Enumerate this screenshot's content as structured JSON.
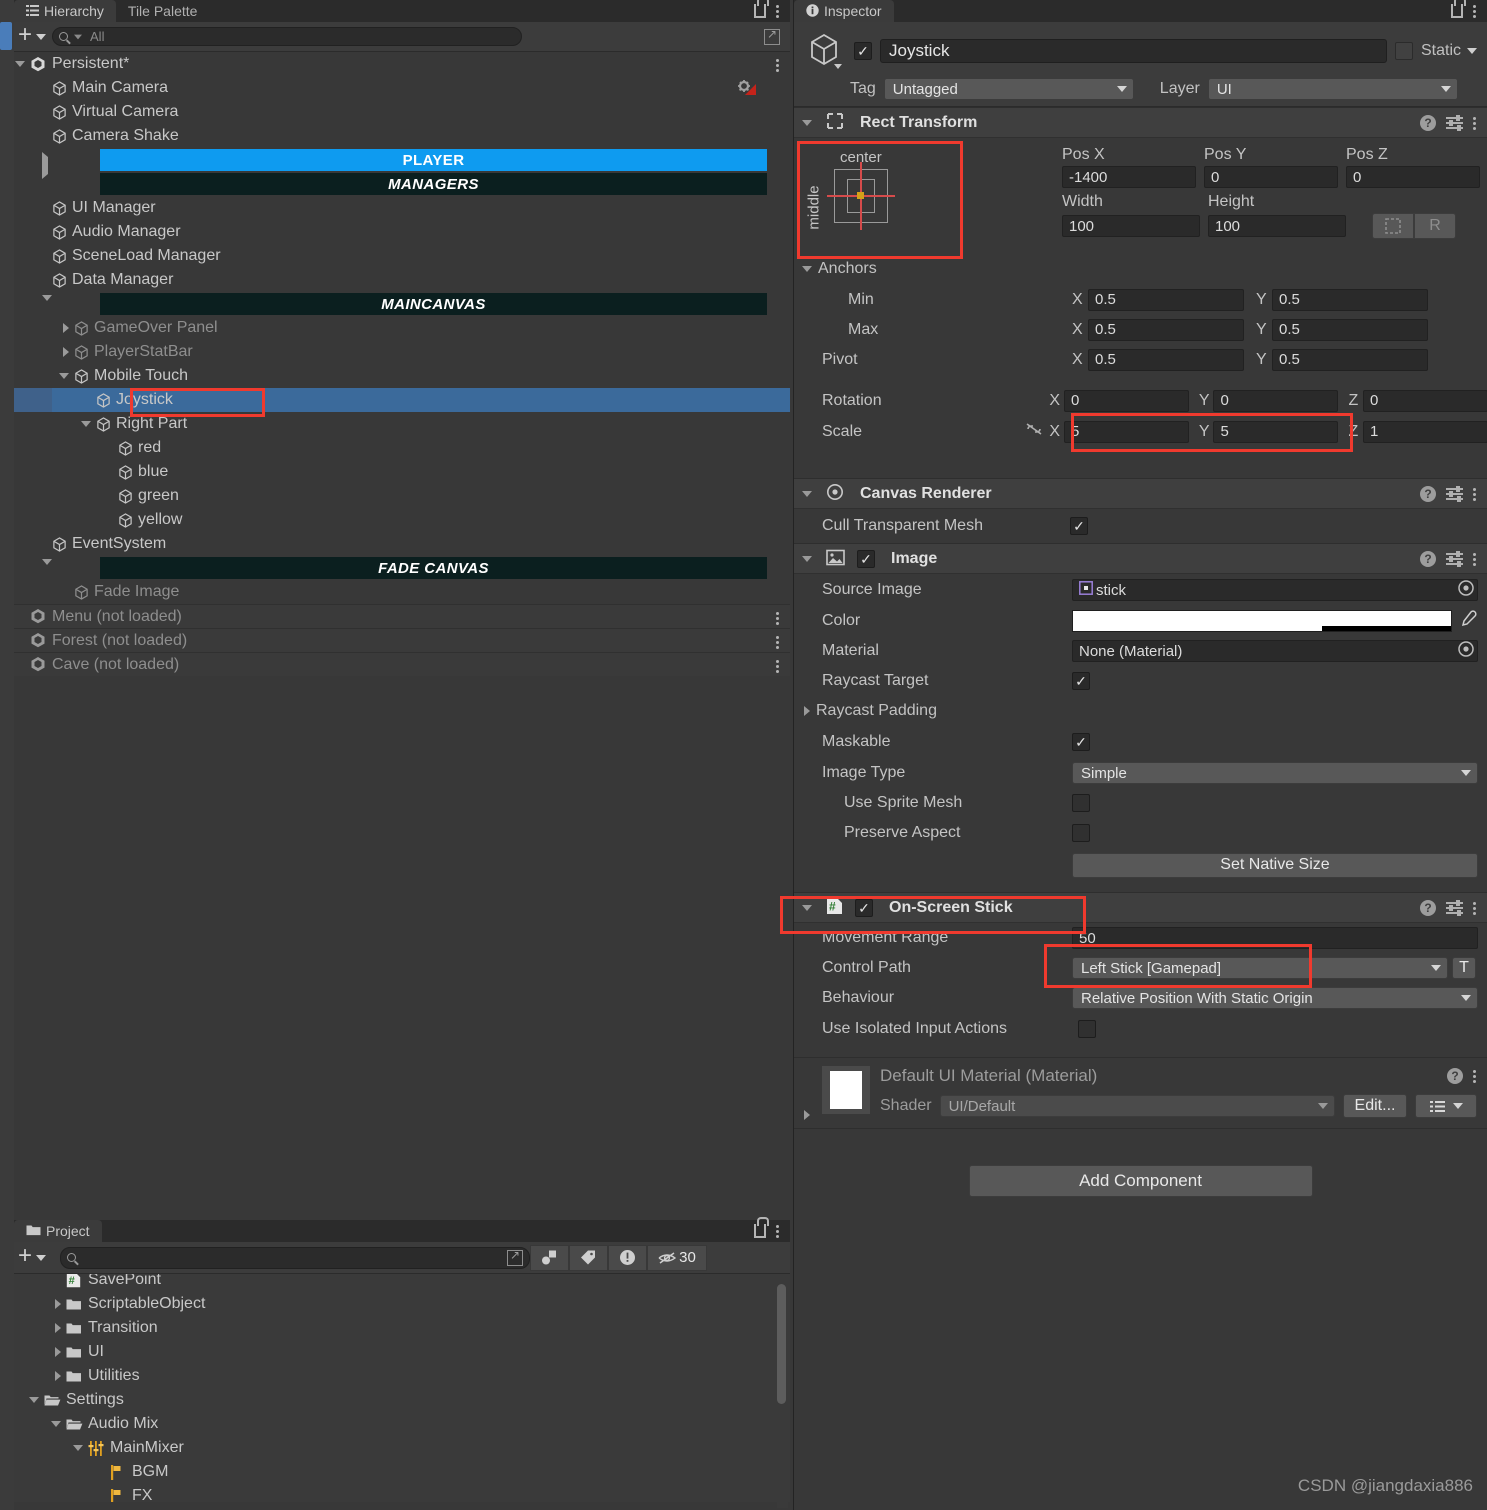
{
  "hierarchy": {
    "tabs": [
      {
        "label": "Hierarchy",
        "icon": "hierarchy-icon",
        "active": true
      },
      {
        "label": "Tile Palette",
        "icon": "tile-palette-icon",
        "active": false
      }
    ],
    "toolbar": {
      "add_label": "+",
      "search_placeholder": "All",
      "search_value": ""
    },
    "rows": [
      {
        "label": "Persistent*",
        "indent": 0,
        "twisty": "down",
        "icon": "unity-scene-icon",
        "kind": "scene",
        "menu": true
      },
      {
        "label": "Main Camera",
        "indent": 1,
        "twisty": "none",
        "icon": "gameobject-icon",
        "kind": "normal",
        "right_icon": "camera-audio-icon"
      },
      {
        "label": "Virtual Camera",
        "indent": 1,
        "twisty": "none",
        "icon": "gameobject-icon",
        "kind": "normal"
      },
      {
        "label": "Camera Shake",
        "indent": 1,
        "twisty": "none",
        "icon": "gameobject-icon",
        "kind": "normal"
      },
      {
        "label": "PLAYER",
        "indent": 1,
        "twisty": "right",
        "icon": "none",
        "kind": "banner-blue"
      },
      {
        "label": "MANAGERS",
        "indent": 1,
        "twisty": "none",
        "icon": "none",
        "kind": "banner-dark"
      },
      {
        "label": "UI Manager",
        "indent": 1,
        "twisty": "none",
        "icon": "gameobject-icon",
        "kind": "normal"
      },
      {
        "label": "Audio Manager",
        "indent": 1,
        "twisty": "none",
        "icon": "gameobject-icon",
        "kind": "normal"
      },
      {
        "label": "SceneLoad Manager",
        "indent": 1,
        "twisty": "none",
        "icon": "gameobject-icon",
        "kind": "normal"
      },
      {
        "label": "Data Manager",
        "indent": 1,
        "twisty": "none",
        "icon": "gameobject-icon",
        "kind": "normal"
      },
      {
        "label": "MAINCANVAS",
        "indent": 1,
        "twisty": "down",
        "icon": "none",
        "kind": "banner-dark"
      },
      {
        "label": "GameOver Panel",
        "indent": 2,
        "twisty": "right",
        "icon": "gameobject-icon",
        "kind": "dim"
      },
      {
        "label": "PlayerStatBar",
        "indent": 2,
        "twisty": "right",
        "icon": "gameobject-icon",
        "kind": "dim"
      },
      {
        "label": "Mobile Touch",
        "indent": 2,
        "twisty": "down",
        "icon": "gameobject-icon",
        "kind": "normal"
      },
      {
        "label": "Joystick",
        "indent": 3,
        "twisty": "none",
        "icon": "gameobject-icon",
        "kind": "selected"
      },
      {
        "label": "Right Part",
        "indent": 3,
        "twisty": "down",
        "icon": "gameobject-icon",
        "kind": "normal"
      },
      {
        "label": "red",
        "indent": 4,
        "twisty": "none",
        "icon": "gameobject-icon",
        "kind": "normal"
      },
      {
        "label": "blue",
        "indent": 4,
        "twisty": "none",
        "icon": "gameobject-icon",
        "kind": "normal"
      },
      {
        "label": "green",
        "indent": 4,
        "twisty": "none",
        "icon": "gameobject-icon",
        "kind": "normal"
      },
      {
        "label": "yellow",
        "indent": 4,
        "twisty": "none",
        "icon": "gameobject-icon",
        "kind": "normal"
      },
      {
        "label": "EventSystem",
        "indent": 1,
        "twisty": "none",
        "icon": "gameobject-icon",
        "kind": "normal"
      },
      {
        "label": "FADE CANVAS",
        "indent": 1,
        "twisty": "down",
        "icon": "none",
        "kind": "banner-dark"
      },
      {
        "label": "Fade Image",
        "indent": 2,
        "twisty": "none",
        "icon": "gameobject-icon",
        "kind": "dim"
      },
      {
        "label": "Menu (not loaded)",
        "indent": 0,
        "twisty": "none",
        "icon": "unity-scene-icon",
        "kind": "notloaded",
        "menu": true
      },
      {
        "label": "Forest (not loaded)",
        "indent": 0,
        "twisty": "none",
        "icon": "unity-scene-icon",
        "kind": "notloaded",
        "menu": true
      },
      {
        "label": "Cave (not loaded)",
        "indent": 0,
        "twisty": "none",
        "icon": "unity-scene-icon",
        "kind": "notloaded",
        "menu": true
      }
    ],
    "highlight_label": "Joystick"
  },
  "inspector": {
    "tab_label": "Inspector",
    "object": {
      "enabled": true,
      "name": "Joystick",
      "static_label": "Static",
      "static_checked": false,
      "tag_label": "Tag",
      "tag_value": "Untagged",
      "layer_label": "Layer",
      "layer_value": "UI"
    },
    "rect_transform": {
      "title": "Rect Transform",
      "anchor_preset": {
        "top_label": "center",
        "side_label": "middle"
      },
      "headers": {
        "pos_x": "Pos X",
        "pos_y": "Pos Y",
        "pos_z": "Pos Z",
        "width": "Width",
        "height": "Height"
      },
      "pos_x": "-1400",
      "pos_y": "0",
      "pos_z": "0",
      "width": "100",
      "height": "100",
      "blueprint_btn": "blueprint-icon",
      "rawedit_btn": "R",
      "anchors_label": "Anchors",
      "min_label": "Min",
      "min_x": "0.5",
      "min_y": "0.5",
      "max_label": "Max",
      "max_x": "0.5",
      "max_y": "0.5",
      "pivot_label": "Pivot",
      "pivot_x": "0.5",
      "pivot_y": "0.5",
      "rotation_label": "Rotation",
      "rot_x": "0",
      "rot_y": "0",
      "rot_z": "0",
      "scale_label": "Scale",
      "scale_x": "5",
      "scale_y": "5",
      "scale_z": "1",
      "axis_x": "X",
      "axis_y": "Y",
      "axis_z": "Z"
    },
    "canvas_renderer": {
      "title": "Canvas Renderer",
      "cull_label": "Cull Transparent Mesh",
      "cull_checked": true
    },
    "image": {
      "title": "Image",
      "enabled": true,
      "source_image_label": "Source Image",
      "source_image_value": "stick",
      "color_label": "Color",
      "color_value": "#FFFFFF",
      "color_alpha_pct": 66,
      "material_label": "Material",
      "material_value": "None (Material)",
      "raycast_target_label": "Raycast Target",
      "raycast_target_checked": true,
      "raycast_padding_label": "Raycast Padding",
      "maskable_label": "Maskable",
      "maskable_checked": true,
      "image_type_label": "Image Type",
      "image_type_value": "Simple",
      "use_sprite_mesh_label": "Use Sprite Mesh",
      "use_sprite_mesh_checked": false,
      "preserve_aspect_label": "Preserve Aspect",
      "preserve_aspect_checked": false,
      "set_native_size_label": "Set Native Size"
    },
    "on_screen_stick": {
      "title": "On-Screen Stick",
      "enabled": true,
      "movement_range_label": "Movement Range",
      "movement_range_value": "50",
      "control_path_label": "Control Path",
      "control_path_value": "Left Stick [Gamepad]",
      "control_path_text_btn": "T",
      "behaviour_label": "Behaviour",
      "behaviour_value": "Relative Position With Static Origin",
      "isolated_label": "Use Isolated Input Actions",
      "isolated_checked": false
    },
    "material_block": {
      "title": "Default UI Material (Material)",
      "shader_label": "Shader",
      "shader_value": "UI/Default",
      "edit_label": "Edit..."
    },
    "add_component_label": "Add Component"
  },
  "project": {
    "tab_label": "Project",
    "toolbar": {
      "add_label": "+",
      "search_value": "",
      "hidden_count": "30"
    },
    "rows": [
      {
        "label": "SavePoint",
        "indent": 2,
        "twisty": "none",
        "icon": "cs-script-icon",
        "clipped": true
      },
      {
        "label": "ScriptableObject",
        "indent": 2,
        "twisty": "right",
        "icon": "folder-icon"
      },
      {
        "label": "Transition",
        "indent": 2,
        "twisty": "right",
        "icon": "folder-icon"
      },
      {
        "label": "UI",
        "indent": 2,
        "twisty": "right",
        "icon": "folder-icon"
      },
      {
        "label": "Utilities",
        "indent": 2,
        "twisty": "right",
        "icon": "folder-icon"
      },
      {
        "label": "Settings",
        "indent": 1,
        "twisty": "down",
        "icon": "folder-open-icon"
      },
      {
        "label": "Audio Mix",
        "indent": 2,
        "twisty": "down",
        "icon": "folder-open-icon"
      },
      {
        "label": "MainMixer",
        "indent": 3,
        "twisty": "down",
        "icon": "mixer-icon"
      },
      {
        "label": "BGM",
        "indent": 4,
        "twisty": "none",
        "icon": "mixer-group-icon"
      },
      {
        "label": "FX",
        "indent": 4,
        "twisty": "none",
        "icon": "mixer-group-icon"
      }
    ]
  },
  "watermark": "CSDN @jiangdaxia886",
  "colors": {
    "panel_bg": "#383838",
    "header_bg": "#3c3c3c",
    "selection_blue": "#3b6a9b",
    "banner_blue": "#0e9bf0",
    "banner_dark": "#0b1f1f",
    "highlight_red": "#f03a2e",
    "field_bg": "#2a2a2a",
    "dropdown_bg": "#585858"
  }
}
